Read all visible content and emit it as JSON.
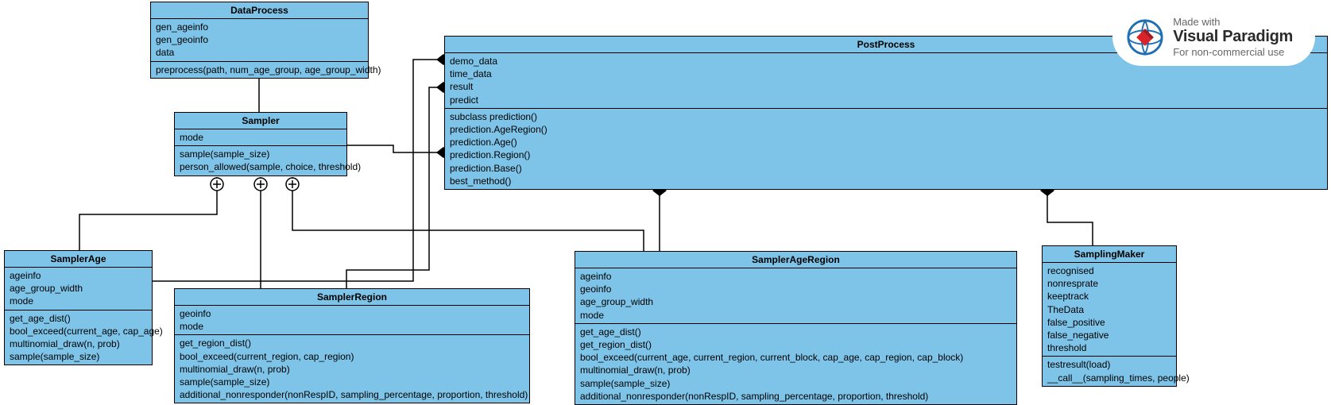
{
  "watermark": {
    "line1": "Made with",
    "line2": "Visual Paradigm",
    "line3": "For non-commercial use"
  },
  "classes": {
    "DataProcess": {
      "title": "DataProcess",
      "attrs": [
        "gen_ageinfo",
        "gen_geoinfo",
        "data"
      ],
      "ops": [
        "preprocess(path, num_age_group, age_group_width)"
      ]
    },
    "Sampler": {
      "title": "Sampler",
      "attrs": [
        "mode"
      ],
      "ops": [
        "sample(sample_size)",
        "person_allowed(sample, choice, threshold)"
      ]
    },
    "PostProcess": {
      "title": "PostProcess",
      "attrs": [
        "demo_data",
        "time_data",
        "result",
        "predict"
      ],
      "ops": [
        "subclass prediction()",
        "prediction.AgeRegion()",
        "prediction.Age()",
        "prediction.Region()",
        "prediction.Base()",
        "best_method()"
      ]
    },
    "SamplerAge": {
      "title": "SamplerAge",
      "attrs": [
        "ageinfo",
        "age_group_width",
        "mode"
      ],
      "ops": [
        "get_age_dist()",
        "bool_exceed(current_age, cap_age)",
        "multinomial_draw(n, prob)",
        "sample(sample_size)"
      ]
    },
    "SamplerRegion": {
      "title": "SamplerRegion",
      "attrs": [
        "geoinfo",
        "mode"
      ],
      "ops": [
        "get_region_dist()",
        "bool_exceed(current_region, cap_region)",
        "multinomial_draw(n, prob)",
        "sample(sample_size)",
        "additional_nonresponder(nonRespID, sampling_percentage, proportion, threshold)"
      ]
    },
    "SamplerAgeRegion": {
      "title": "SamplerAgeRegion",
      "attrs": [
        "ageinfo",
        "geoinfo",
        "age_group_width",
        "mode"
      ],
      "ops": [
        "get_age_dist()",
        "get_region_dist()",
        "bool_exceed(current_age, current_region, current_block, cap_age, cap_region, cap_block)",
        "multinomial_draw(n, prob)",
        "sample(sample_size)",
        "additional_nonresponder(nonRespID, sampling_percentage, proportion, threshold)"
      ]
    },
    "SamplingMaker": {
      "title": "SamplingMaker",
      "attrs": [
        "recognised",
        "nonresprate",
        "keeptrack",
        "TheData",
        "false_positive",
        "false_negative",
        "threshold"
      ],
      "ops": [
        "testresult(load)",
        "__call__(sampling_times, people)"
      ]
    }
  },
  "chart_data": {
    "type": "diagram",
    "diagram_type": "uml-class",
    "classes": [
      {
        "name": "DataProcess",
        "attributes": [
          "gen_ageinfo",
          "gen_geoinfo",
          "data"
        ],
        "operations": [
          "preprocess(path, num_age_group, age_group_width)"
        ]
      },
      {
        "name": "Sampler",
        "attributes": [
          "mode"
        ],
        "operations": [
          "sample(sample_size)",
          "person_allowed(sample, choice, threshold)"
        ]
      },
      {
        "name": "PostProcess",
        "attributes": [
          "demo_data",
          "time_data",
          "result",
          "predict"
        ],
        "operations": [
          "subclass prediction()",
          "prediction.AgeRegion()",
          "prediction.Age()",
          "prediction.Region()",
          "prediction.Base()",
          "best_method()"
        ]
      },
      {
        "name": "SamplerAge",
        "attributes": [
          "ageinfo",
          "age_group_width",
          "mode"
        ],
        "operations": [
          "get_age_dist()",
          "bool_exceed(current_age, cap_age)",
          "multinomial_draw(n, prob)",
          "sample(sample_size)"
        ]
      },
      {
        "name": "SamplerRegion",
        "attributes": [
          "geoinfo",
          "mode"
        ],
        "operations": [
          "get_region_dist()",
          "bool_exceed(current_region, cap_region)",
          "multinomial_draw(n, prob)",
          "sample(sample_size)",
          "additional_nonresponder(nonRespID, sampling_percentage, proportion, threshold)"
        ]
      },
      {
        "name": "SamplerAgeRegion",
        "attributes": [
          "ageinfo",
          "geoinfo",
          "age_group_width",
          "mode"
        ],
        "operations": [
          "get_age_dist()",
          "get_region_dist()",
          "bool_exceed(current_age, current_region, current_block, cap_age, cap_region, cap_block)",
          "multinomial_draw(n, prob)",
          "sample(sample_size)",
          "additional_nonresponder(nonRespID, sampling_percentage, proportion, threshold)"
        ]
      },
      {
        "name": "SamplingMaker",
        "attributes": [
          "recognised",
          "nonresprate",
          "keeptrack",
          "TheData",
          "false_positive",
          "false_negative",
          "threshold"
        ],
        "operations": [
          "testresult(load)",
          "__call__(sampling_times, people)"
        ]
      }
    ],
    "relationships": [
      {
        "from": "DataProcess",
        "to": "Sampler",
        "type": "nested/containment"
      },
      {
        "from": "Sampler",
        "to": "SamplerAge",
        "type": "nested/containment"
      },
      {
        "from": "Sampler",
        "to": "SamplerRegion",
        "type": "nested/containment"
      },
      {
        "from": "Sampler",
        "to": "SamplerAgeRegion",
        "type": "nested/containment"
      },
      {
        "from": "Sampler",
        "to": "PostProcess",
        "type": "composition"
      },
      {
        "from": "SamplerAge",
        "to": "PostProcess",
        "type": "composition"
      },
      {
        "from": "SamplerRegion",
        "to": "PostProcess",
        "type": "composition"
      },
      {
        "from": "SamplerAgeRegion",
        "to": "PostProcess",
        "type": "composition"
      },
      {
        "from": "SamplingMaker",
        "to": "PostProcess",
        "type": "composition"
      }
    ]
  }
}
